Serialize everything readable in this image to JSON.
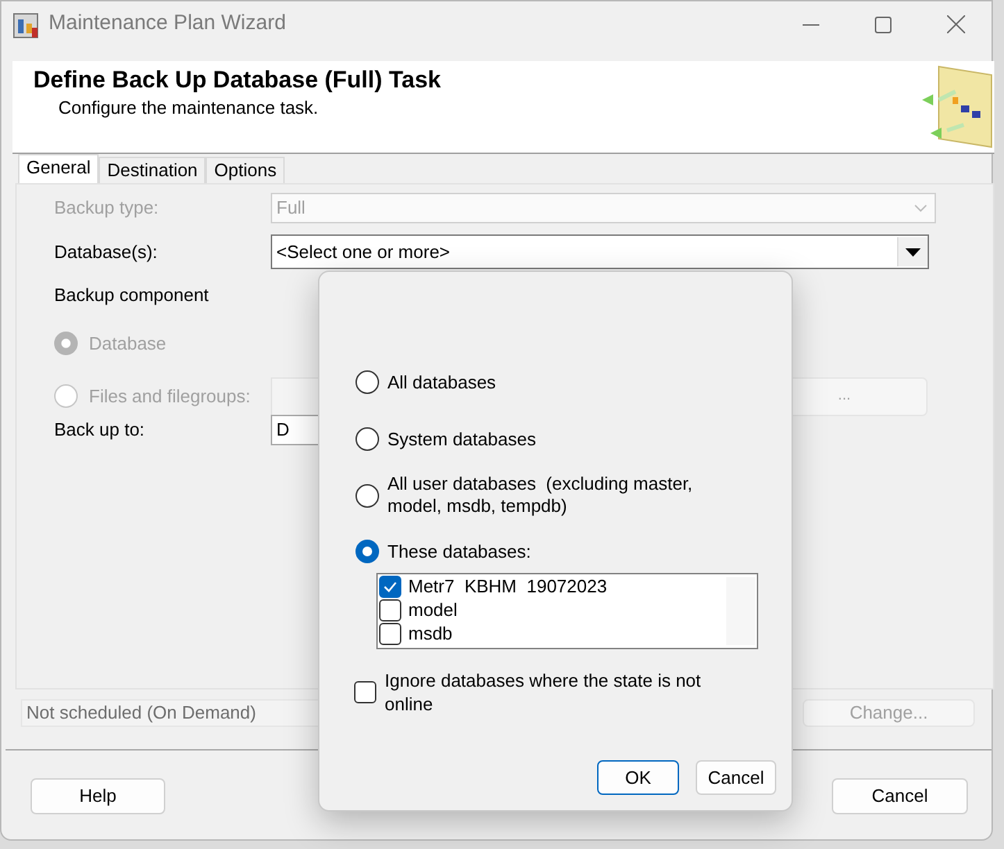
{
  "window": {
    "title": "Maintenance Plan Wizard"
  },
  "header": {
    "title": "Define Back Up Database (Full) Task",
    "subtitle": "Configure the maintenance task."
  },
  "tabs": [
    {
      "label": "General",
      "selected": true
    },
    {
      "label": "Destination",
      "selected": false
    },
    {
      "label": "Options",
      "selected": false
    }
  ],
  "form": {
    "backup_type": {
      "label": "Backup type:",
      "value": "Full",
      "disabled": true
    },
    "databases": {
      "label": "Database(s):",
      "value": "<Select one or more>"
    },
    "backup_component": {
      "label": "Backup component",
      "options": [
        {
          "label": "Database",
          "selected": true,
          "disabled": true
        },
        {
          "label": "Files and filegroups:",
          "selected": false,
          "disabled": true
        }
      ]
    },
    "browse_button": {
      "label": "...",
      "disabled": true
    },
    "back_up_to": {
      "label": "Back up to:",
      "value": "D"
    }
  },
  "schedule": {
    "value": "Not scheduled (On Demand)",
    "disabled": true,
    "change_button": {
      "label": "Change...",
      "disabled": true
    }
  },
  "buttons": [
    "Help",
    "Cancel"
  ],
  "popup": {
    "options": [
      {
        "label": "All databases",
        "selected": false
      },
      {
        "label": "System databases",
        "selected": false
      },
      {
        "label": "All user databases  (excluding master, model, msdb, tempdb)",
        "selected": false
      },
      {
        "label": "These databases:",
        "selected": true
      }
    ],
    "database_list": [
      {
        "name": "Metr7  KBHM  19072023",
        "checked": true
      },
      {
        "name": "model",
        "checked": false
      },
      {
        "name": "msdb",
        "checked": false
      }
    ],
    "ignore_offline": {
      "label": "Ignore databases where the state is not online",
      "checked": false
    },
    "buttons": [
      "OK",
      "Cancel"
    ]
  }
}
